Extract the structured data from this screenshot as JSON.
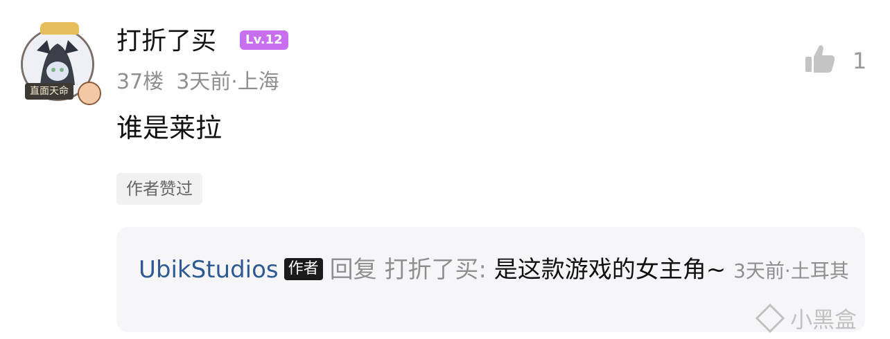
{
  "comment": {
    "avatar_frame_text": "直面天命",
    "username": "打折了买",
    "level": "Lv.12",
    "floor": "37楼",
    "time_location": "3天前·上海",
    "content": "谁是莱拉",
    "tag": "作者赞过",
    "like_count": "1"
  },
  "reply": {
    "author": "UbikStudios",
    "author_badge": "作者",
    "verb": "回复",
    "target": "打折了买:",
    "text": "是这款游戏的女主角~",
    "time_location": "3天前·土耳其"
  },
  "watermark": "小黑盒",
  "colors": {
    "level_badge": "#c86ff0",
    "reply_author": "#2d5a93",
    "muted_text": "#8f8f8f",
    "reply_bg": "#f6f6f8"
  }
}
